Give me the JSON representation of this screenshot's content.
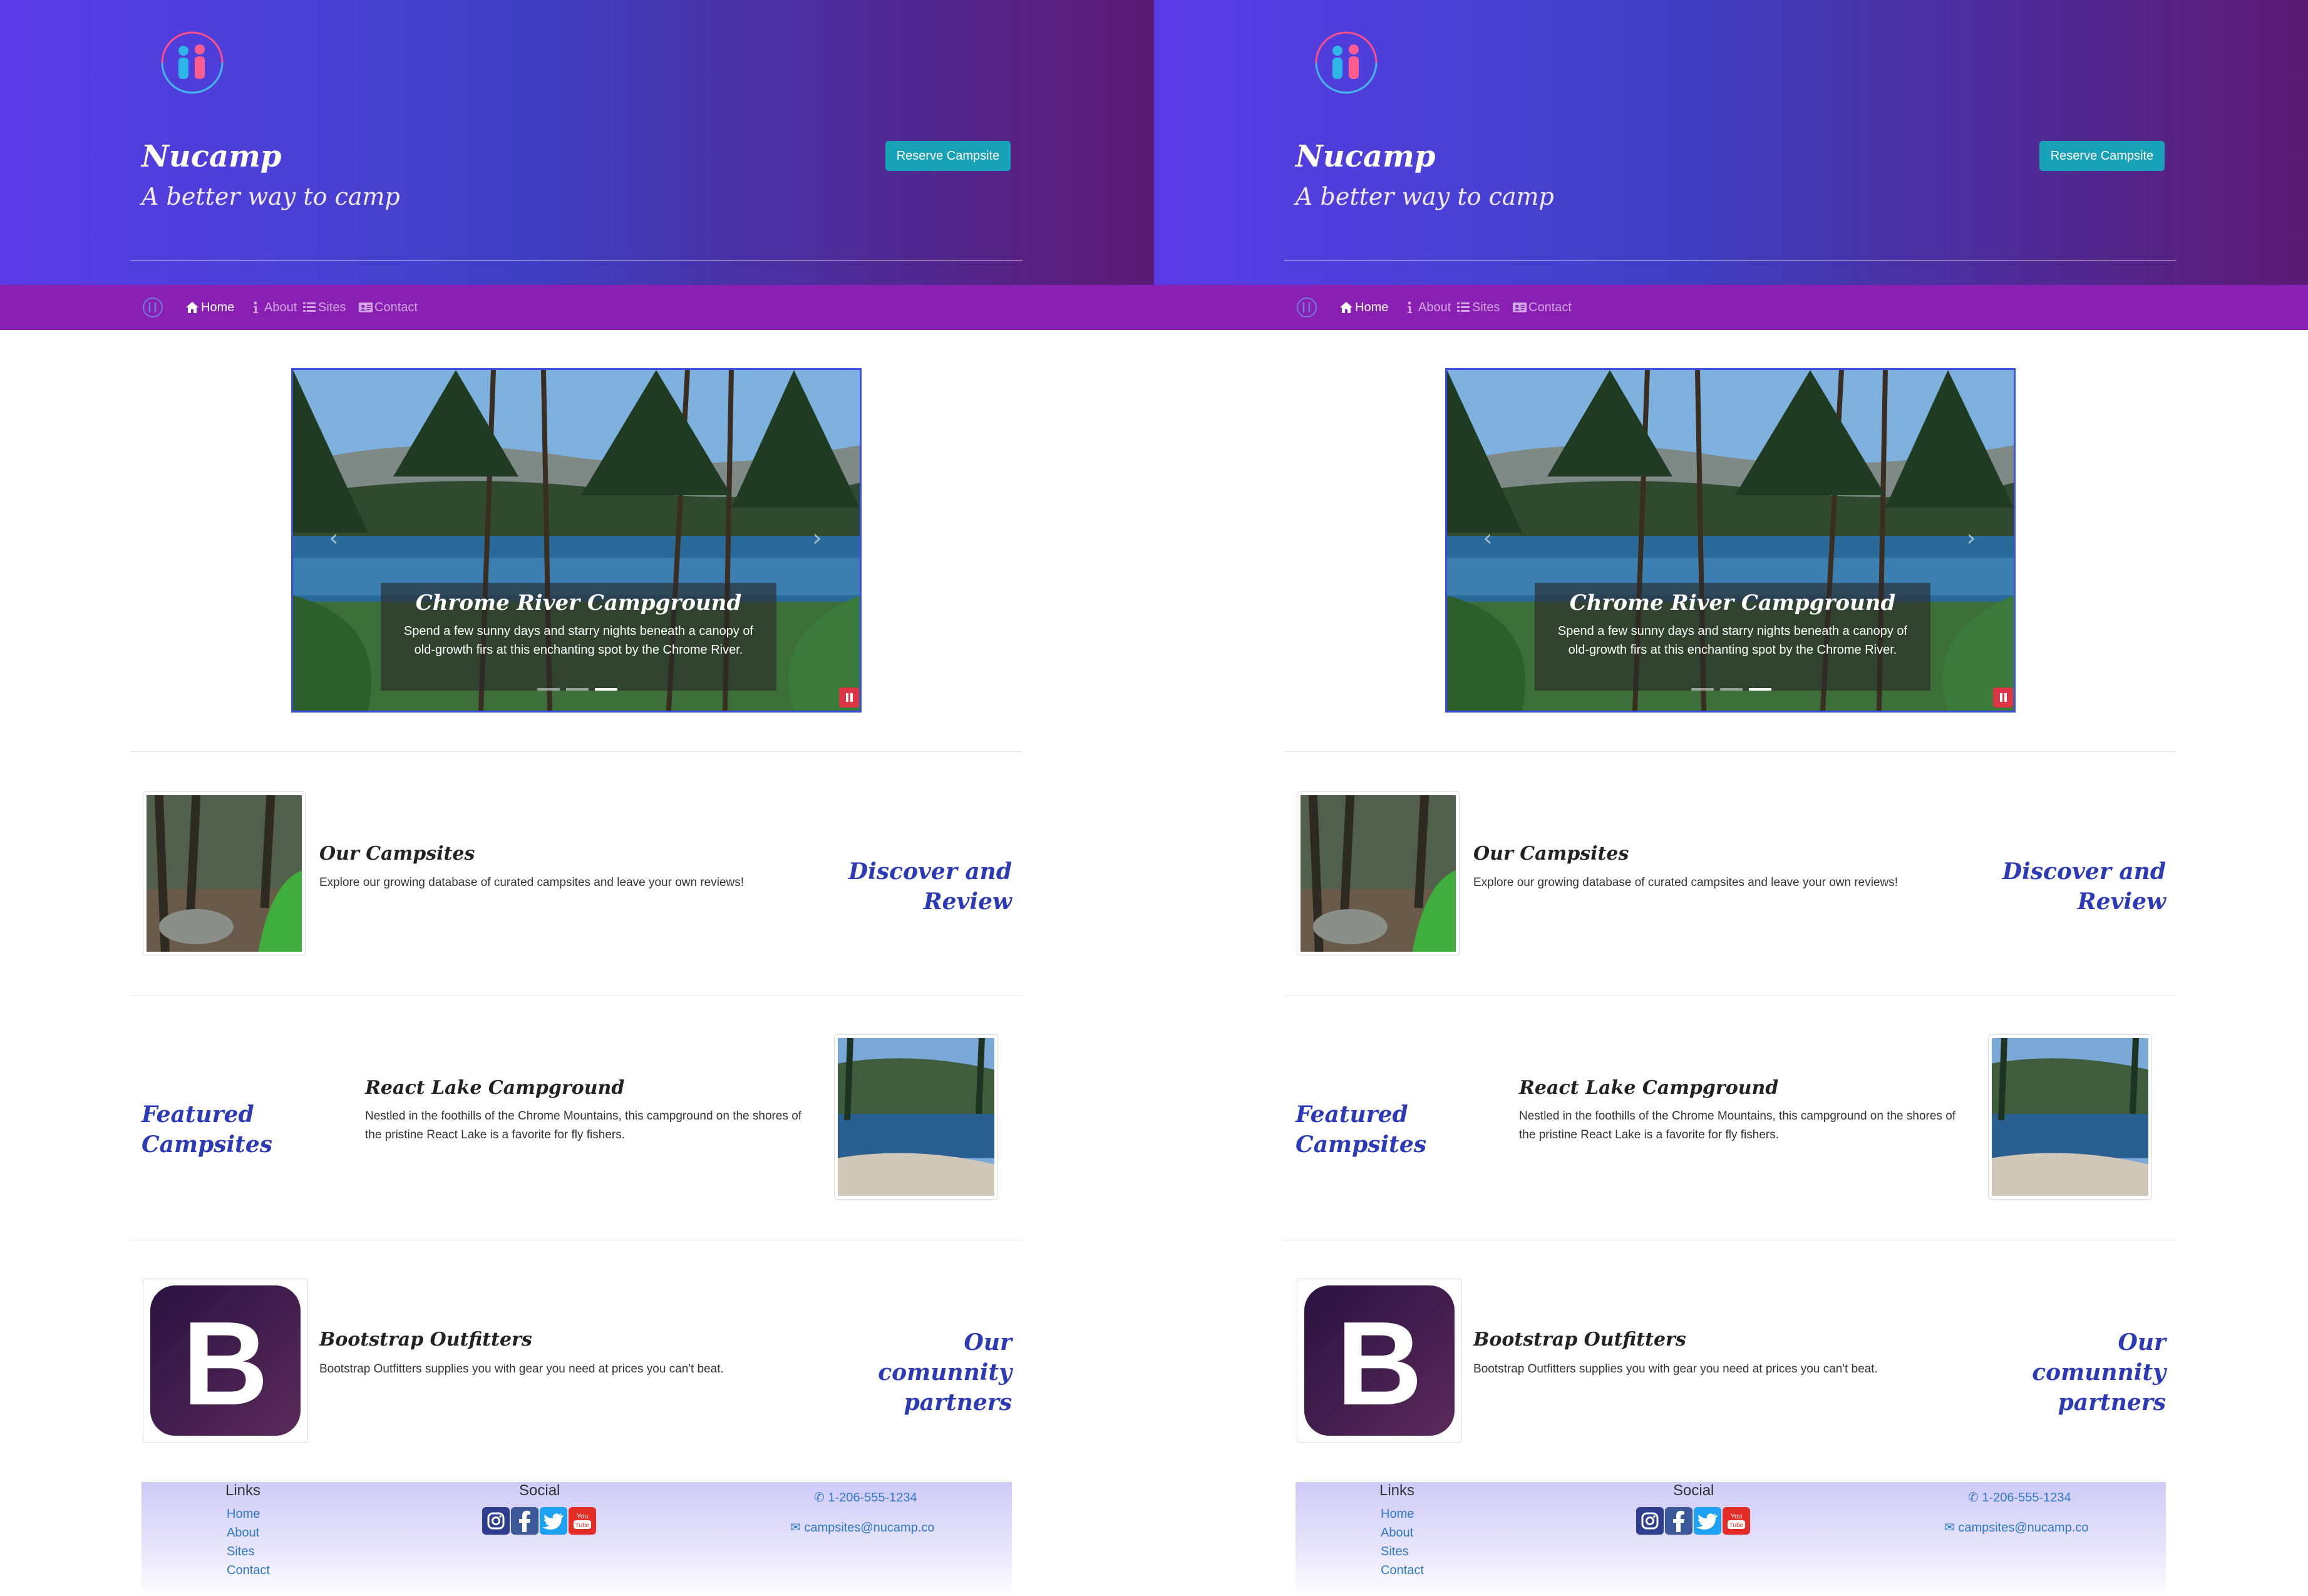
{
  "brand": {
    "name": "Nucamp",
    "tagline": "A better way to camp",
    "reserve_label": "Reserve Campsite"
  },
  "nav": {
    "items": [
      {
        "label": "Home",
        "icon": "home-icon",
        "active": true
      },
      {
        "label": "About",
        "icon": "info-icon",
        "active": false
      },
      {
        "label": "Sites",
        "icon": "list-icon",
        "active": false
      },
      {
        "label": "Contact",
        "icon": "address-card-icon",
        "active": false
      }
    ]
  },
  "carousel": {
    "title": "Chrome River Campground",
    "text": "Spend a few sunny days and starry nights beneath a canopy of old-growth firs at this enchanting spot by the Chrome River.",
    "slide_count": 3,
    "active_slide": 3
  },
  "campsites": {
    "title": "Our Campsites",
    "text": "Explore our growing database of curated campsites and leave your own reviews!",
    "label": "Discover and Review"
  },
  "featured": {
    "label": "Featured Campsites",
    "title": "React Lake Campground",
    "text": "Nestled in the foothills of the Chrome Mountains, this campground on the shores of the pristine React Lake is a favorite for fly fishers."
  },
  "partners": {
    "title": "Bootstrap Outfitters",
    "text": "Bootstrap Outfitters supplies you with gear you need at prices you can't beat.",
    "label": "Our comunnity partners",
    "logo_letter": "B"
  },
  "footer": {
    "links_heading": "Links",
    "links": [
      "Home",
      "About",
      "Sites",
      "Contact"
    ],
    "social_heading": "Social",
    "social": [
      "instagram-icon",
      "facebook-icon",
      "twitter-icon",
      "youtube-icon"
    ],
    "phone": "1-206-555-1234",
    "email": "campsites@nucamp.co"
  },
  "colors": {
    "accent": "#17a2b8",
    "nav": "#8a1fb3",
    "heading_blue": "#2c3ab8",
    "link": "#2f7ac7"
  }
}
